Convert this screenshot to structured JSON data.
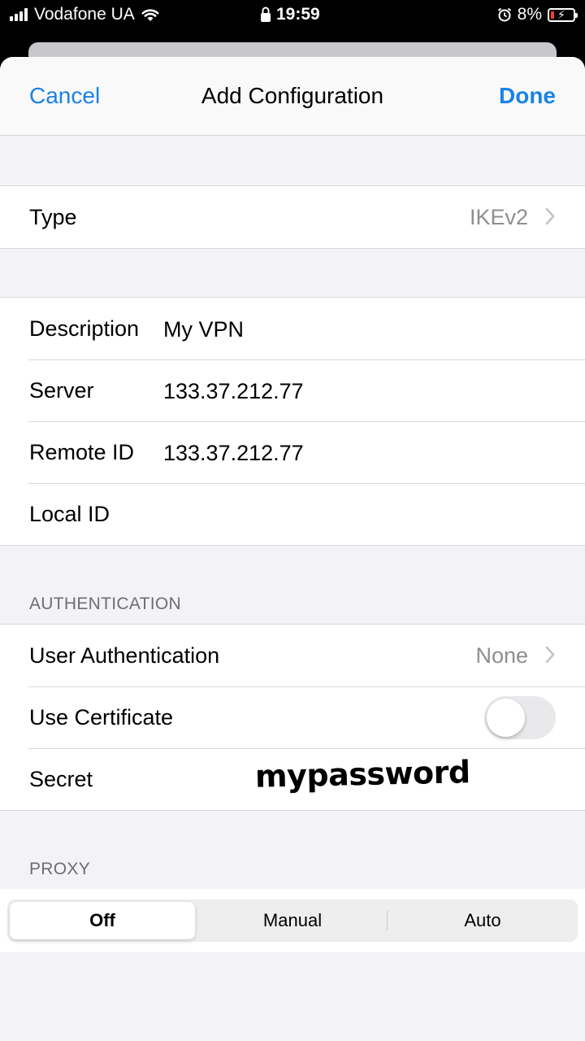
{
  "status_bar": {
    "carrier": "Vodafone UA",
    "time": "19:59",
    "battery_percent": "8%",
    "icons": [
      "signal-icon",
      "wifi-icon",
      "lock-icon",
      "alarm-icon",
      "battery-charging-icon"
    ]
  },
  "navbar": {
    "cancel_label": "Cancel",
    "title": "Add Configuration",
    "done_label": "Done"
  },
  "type_group": {
    "label": "Type",
    "value": "IKEv2"
  },
  "details": {
    "description_label": "Description",
    "description_value": "My VPN",
    "server_label": "Server",
    "server_value": "133.37.212.77",
    "remote_id_label": "Remote ID",
    "remote_id_value": "133.37.212.77",
    "local_id_label": "Local ID",
    "local_id_value": ""
  },
  "authentication": {
    "header": "AUTHENTICATION",
    "user_auth_label": "User Authentication",
    "user_auth_value": "None",
    "use_cert_label": "Use Certificate",
    "use_cert_on": false,
    "secret_label": "Secret",
    "secret_value": "mypassword"
  },
  "proxy": {
    "header": "PROXY",
    "options": [
      "Off",
      "Manual",
      "Auto"
    ],
    "selected": "Off"
  },
  "colors": {
    "accent": "#1a82e6",
    "grouped_background": "#f2f2f7",
    "secondary_text": "#8e8e93",
    "battery_low": "#ff3b30"
  }
}
